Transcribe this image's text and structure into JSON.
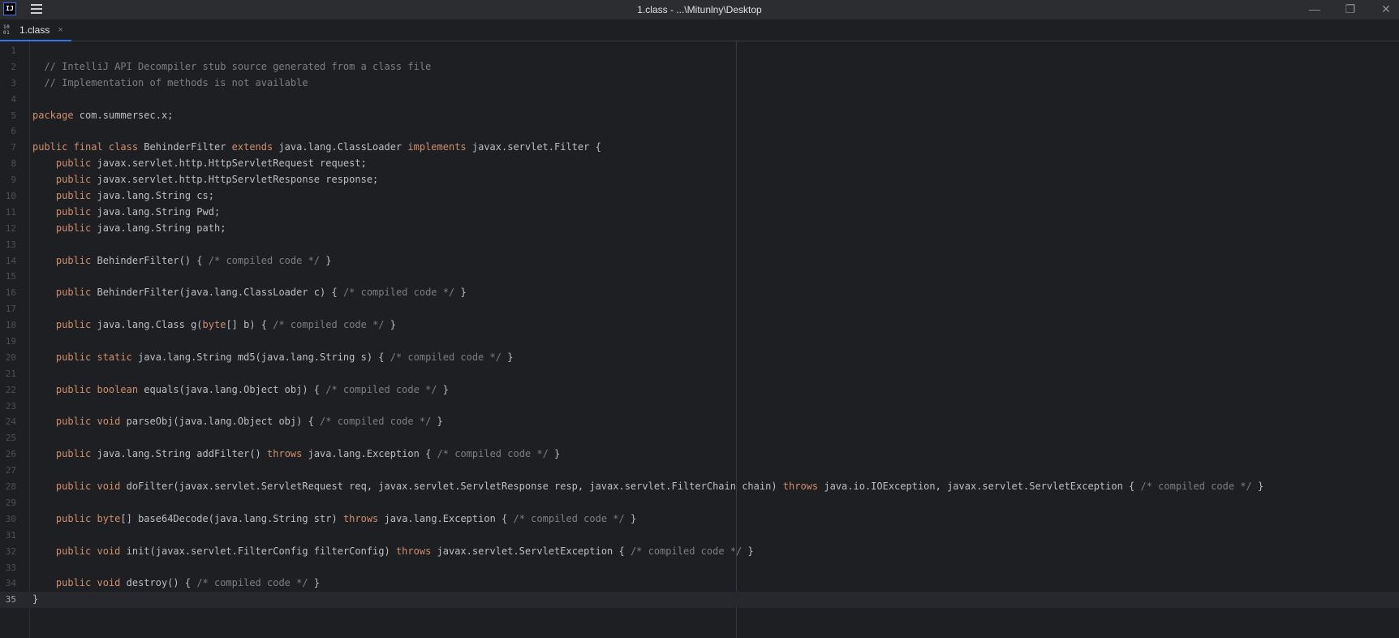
{
  "window": {
    "app_icon_text": "IJ",
    "title": "1.class - ...\\Mitunlny\\Desktop",
    "minimize": "—",
    "maximize": "❐",
    "close": "✕"
  },
  "tab": {
    "icon_text_top": "10",
    "icon_text_bottom": "01",
    "label": "1.class",
    "close": "×"
  },
  "editor": {
    "current_line": 35,
    "lines": [
      [],
      [
        {
          "t": "  // IntelliJ API Decompiler stub source generated from a class file",
          "c": "cm"
        }
      ],
      [
        {
          "t": "  // Implementation of methods is not available",
          "c": "cm"
        }
      ],
      [],
      [
        {
          "t": "package",
          "c": "kw"
        },
        {
          "t": " com.summersec.x;"
        }
      ],
      [],
      [
        {
          "t": "public final class",
          "c": "kw"
        },
        {
          "t": " BehinderFilter "
        },
        {
          "t": "extends",
          "c": "kw"
        },
        {
          "t": " java.lang.ClassLoader "
        },
        {
          "t": "implements",
          "c": "kw"
        },
        {
          "t": " javax.servlet.Filter {"
        }
      ],
      [
        {
          "t": "    "
        },
        {
          "t": "public",
          "c": "kw"
        },
        {
          "t": " javax.servlet.http.HttpServletRequest request;"
        }
      ],
      [
        {
          "t": "    "
        },
        {
          "t": "public",
          "c": "kw"
        },
        {
          "t": " javax.servlet.http.HttpServletResponse response;"
        }
      ],
      [
        {
          "t": "    "
        },
        {
          "t": "public",
          "c": "kw"
        },
        {
          "t": " java.lang.String cs;"
        }
      ],
      [
        {
          "t": "    "
        },
        {
          "t": "public",
          "c": "kw"
        },
        {
          "t": " java.lang.String Pwd;"
        }
      ],
      [
        {
          "t": "    "
        },
        {
          "t": "public",
          "c": "kw"
        },
        {
          "t": " java.lang.String path;"
        }
      ],
      [],
      [
        {
          "t": "    "
        },
        {
          "t": "public",
          "c": "kw"
        },
        {
          "t": " BehinderFilter() { "
        },
        {
          "t": "/* compiled code */",
          "c": "cm"
        },
        {
          "t": " }"
        }
      ],
      [],
      [
        {
          "t": "    "
        },
        {
          "t": "public",
          "c": "kw"
        },
        {
          "t": " BehinderFilter(java.lang.ClassLoader c) { "
        },
        {
          "t": "/* compiled code */",
          "c": "cm"
        },
        {
          "t": " }"
        }
      ],
      [],
      [
        {
          "t": "    "
        },
        {
          "t": "public",
          "c": "kw"
        },
        {
          "t": " java.lang.Class g("
        },
        {
          "t": "byte",
          "c": "kw"
        },
        {
          "t": "[] b) { "
        },
        {
          "t": "/* compiled code */",
          "c": "cm"
        },
        {
          "t": " }"
        }
      ],
      [],
      [
        {
          "t": "    "
        },
        {
          "t": "public static",
          "c": "kw"
        },
        {
          "t": " java.lang.String md5(java.lang.String s) { "
        },
        {
          "t": "/* compiled code */",
          "c": "cm"
        },
        {
          "t": " }"
        }
      ],
      [],
      [
        {
          "t": "    "
        },
        {
          "t": "public boolean",
          "c": "kw"
        },
        {
          "t": " equals(java.lang.Object obj) { "
        },
        {
          "t": "/* compiled code */",
          "c": "cm"
        },
        {
          "t": " }"
        }
      ],
      [],
      [
        {
          "t": "    "
        },
        {
          "t": "public void",
          "c": "kw"
        },
        {
          "t": " parseObj(java.lang.Object obj) { "
        },
        {
          "t": "/* compiled code */",
          "c": "cm"
        },
        {
          "t": " }"
        }
      ],
      [],
      [
        {
          "t": "    "
        },
        {
          "t": "public",
          "c": "kw"
        },
        {
          "t": " java.lang.String addFilter() "
        },
        {
          "t": "throws",
          "c": "kw"
        },
        {
          "t": " java.lang.Exception { "
        },
        {
          "t": "/* compiled code */",
          "c": "cm"
        },
        {
          "t": " }"
        }
      ],
      [],
      [
        {
          "t": "    "
        },
        {
          "t": "public void",
          "c": "kw"
        },
        {
          "t": " doFilter(javax.servlet.ServletRequest req, javax.servlet.ServletResponse resp, javax.servlet.FilterChain chain) "
        },
        {
          "t": "throws",
          "c": "kw"
        },
        {
          "t": " java.io.IOException, javax.servlet.ServletException { "
        },
        {
          "t": "/* compiled code */",
          "c": "cm"
        },
        {
          "t": " }"
        }
      ],
      [],
      [
        {
          "t": "    "
        },
        {
          "t": "public byte",
          "c": "kw"
        },
        {
          "t": "[] base64Decode(java.lang.String str) "
        },
        {
          "t": "throws",
          "c": "kw"
        },
        {
          "t": " java.lang.Exception { "
        },
        {
          "t": "/* compiled code */",
          "c": "cm"
        },
        {
          "t": " }"
        }
      ],
      [],
      [
        {
          "t": "    "
        },
        {
          "t": "public void",
          "c": "kw"
        },
        {
          "t": " init(javax.servlet.FilterConfig filterConfig) "
        },
        {
          "t": "throws",
          "c": "kw"
        },
        {
          "t": " javax.servlet.ServletException { "
        },
        {
          "t": "/* compiled code */",
          "c": "cm"
        },
        {
          "t": " }"
        }
      ],
      [],
      [
        {
          "t": "    "
        },
        {
          "t": "public void",
          "c": "kw"
        },
        {
          "t": " destroy() { "
        },
        {
          "t": "/* compiled code */",
          "c": "cm"
        },
        {
          "t": " }"
        }
      ],
      [
        {
          "t": "}"
        }
      ]
    ]
  }
}
